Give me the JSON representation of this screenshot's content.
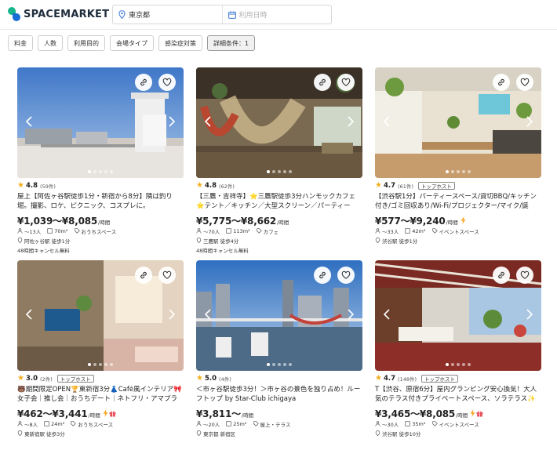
{
  "header": {
    "logo_text": "SPACEMARKET",
    "search": {
      "place": "東京都",
      "date_placeholder": "利用日時"
    }
  },
  "filters": [
    {
      "label": "料金",
      "active": false
    },
    {
      "label": "人数",
      "active": false
    },
    {
      "label": "利用目的",
      "active": false
    },
    {
      "label": "会場タイプ",
      "active": false
    },
    {
      "label": "感染症対策",
      "active": false
    },
    {
      "label": "詳細条件：1",
      "active": true
    }
  ],
  "listings": [
    {
      "rating": "4.8",
      "reviews": "(59件)",
      "host_badge": "",
      "title": "屋上【阿佐ヶ谷駅徒歩1分・新宿から8分】隣は釣り堀。撮影、ロケ、ピクニック、コスプレに。",
      "price": "¥1,039〜¥8,085",
      "unit": "/時間",
      "instant": false,
      "gift": false,
      "capacity": "〜13人",
      "area": "70m²",
      "tag": "おうちスペース",
      "station": "阿佐ヶ谷駅 徒歩1分",
      "cancel": "48時間キャンセル無料"
    },
    {
      "rating": "4.8",
      "reviews": "(62件)",
      "host_badge": "",
      "title": "【三鷹・吉祥寺】⭐三鷹駅徒歩3分ハンモックカフェ⭐テント／キッチン／大型スクリーン／パーティー／〜",
      "price": "¥5,775〜¥8,662",
      "unit": "/時間",
      "instant": false,
      "gift": false,
      "capacity": "〜70人",
      "area": "113m²",
      "tag": "カフェ",
      "station": "三鷹駅 徒歩4分",
      "cancel": "48時間キャンセル無料"
    },
    {
      "rating": "4.7",
      "reviews": "(61件)",
      "host_badge": "トップホスト",
      "title": "【渋谷駅1分】パーティースペース/貸切BBQ/キッチン付き/ゴミ回収あり/Wi-Fi/プロジェクター/マイク/誕",
      "price": "¥577〜¥9,240",
      "unit": "/時間",
      "instant": true,
      "gift": false,
      "capacity": "〜33人",
      "area": "42m²",
      "tag": "イベントスペース",
      "station": "渋谷駅 徒歩1分",
      "cancel": ""
    },
    {
      "rating": "3.0",
      "reviews": "(2件)",
      "host_badge": "トップホスト",
      "title": "🐻期間限定OPEN🏆東新宿3分👗Café風インテリア🎀女子会｜推し会｜おうちデート｜ネトフリ・アマプラ",
      "price": "¥462〜¥3,441",
      "unit": "/時間",
      "instant": true,
      "gift": true,
      "capacity": "〜8人",
      "area": "24m²",
      "tag": "おうちスペース",
      "station": "東新宿駅 徒歩3分",
      "cancel": ""
    },
    {
      "rating": "5.0",
      "reviews": "(4件)",
      "host_badge": "",
      "title": "＜市ヶ谷駅徒歩3分！＞市ヶ谷の景色を独り占め！ルーフトップ by Star-Club ichigaya",
      "price": "¥3,811〜",
      "unit": "/時間",
      "instant": false,
      "gift": false,
      "capacity": "〜20人",
      "area": "25m²",
      "tag": "屋上・テラス",
      "station": "東京都 新宿区",
      "cancel": ""
    },
    {
      "rating": "4.7",
      "reviews": "(148件)",
      "host_badge": "トップホスト",
      "title": "T【渋谷、原宿6分】屋内グランピング安心換気！大人気のテラス付きプライベートスペース、ソラテラス✨",
      "price": "¥3,465〜¥8,085",
      "unit": "/時間",
      "instant": true,
      "gift": true,
      "capacity": "〜30人",
      "area": "35m²",
      "tag": "イベントスペース",
      "station": "渋谷駅 徒歩10分",
      "cancel": ""
    }
  ],
  "colors": {
    "brand_green": "#18b58c",
    "brand_blue": "#1a6fd4",
    "star": "#f2b01e",
    "bolt": "#f5a623",
    "gift": "#e8505b"
  },
  "icons": [
    "location-pin-icon",
    "calendar-icon",
    "link-icon",
    "heart-icon",
    "chevron-left-icon",
    "chevron-right-icon",
    "star-icon",
    "person-icon",
    "area-icon",
    "tag-icon",
    "station-pin-icon",
    "lightning-icon",
    "gift-icon"
  ]
}
